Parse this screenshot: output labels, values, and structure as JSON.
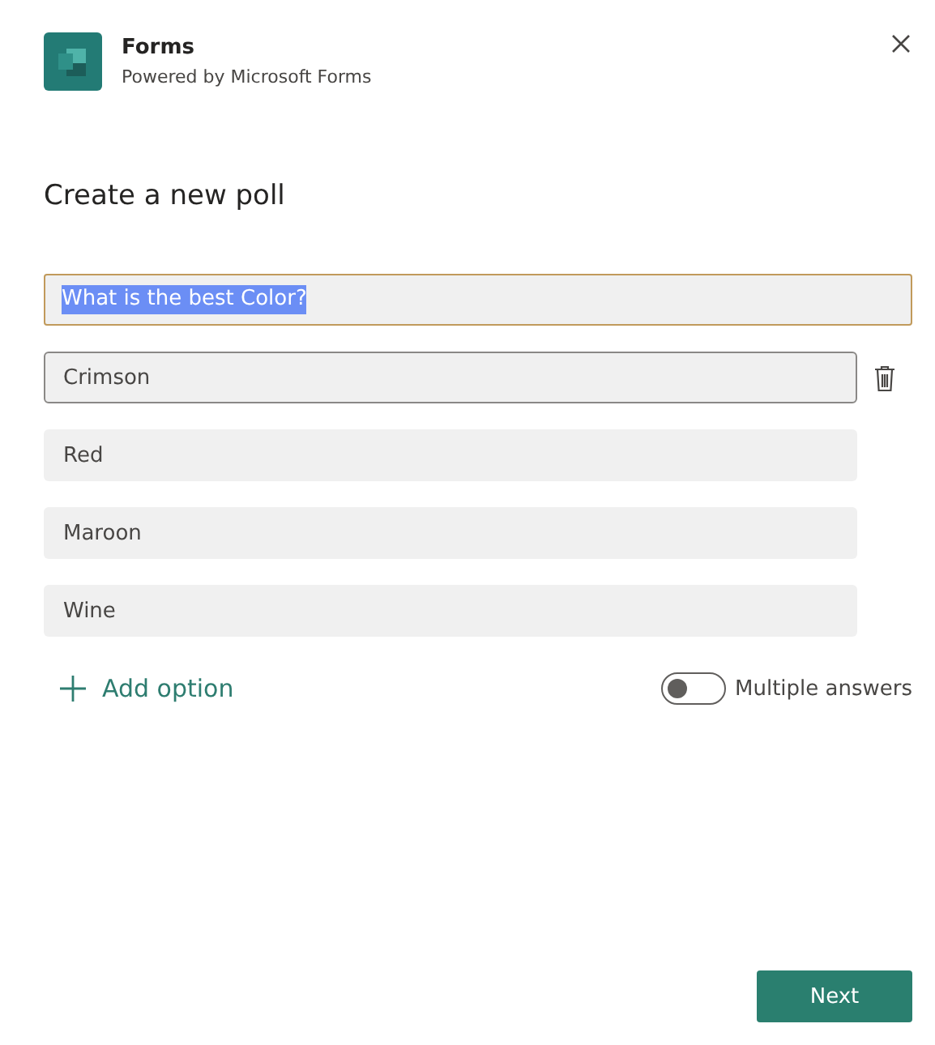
{
  "app": {
    "name": "Forms",
    "subtitle": "Powered by Microsoft Forms"
  },
  "heading": "Create a new poll",
  "question": {
    "value": "What is the best Color?",
    "focused": true,
    "text_selected": true
  },
  "options": [
    {
      "value": "Crimson",
      "focused": true
    },
    {
      "value": "Red",
      "focused": false
    },
    {
      "value": "Maroon",
      "focused": false
    },
    {
      "value": "Wine",
      "focused": false
    }
  ],
  "add_option": "Add option",
  "multiple_answers": {
    "label": "Multiple answers",
    "on": false
  },
  "buttons": [
    "Next"
  ]
}
